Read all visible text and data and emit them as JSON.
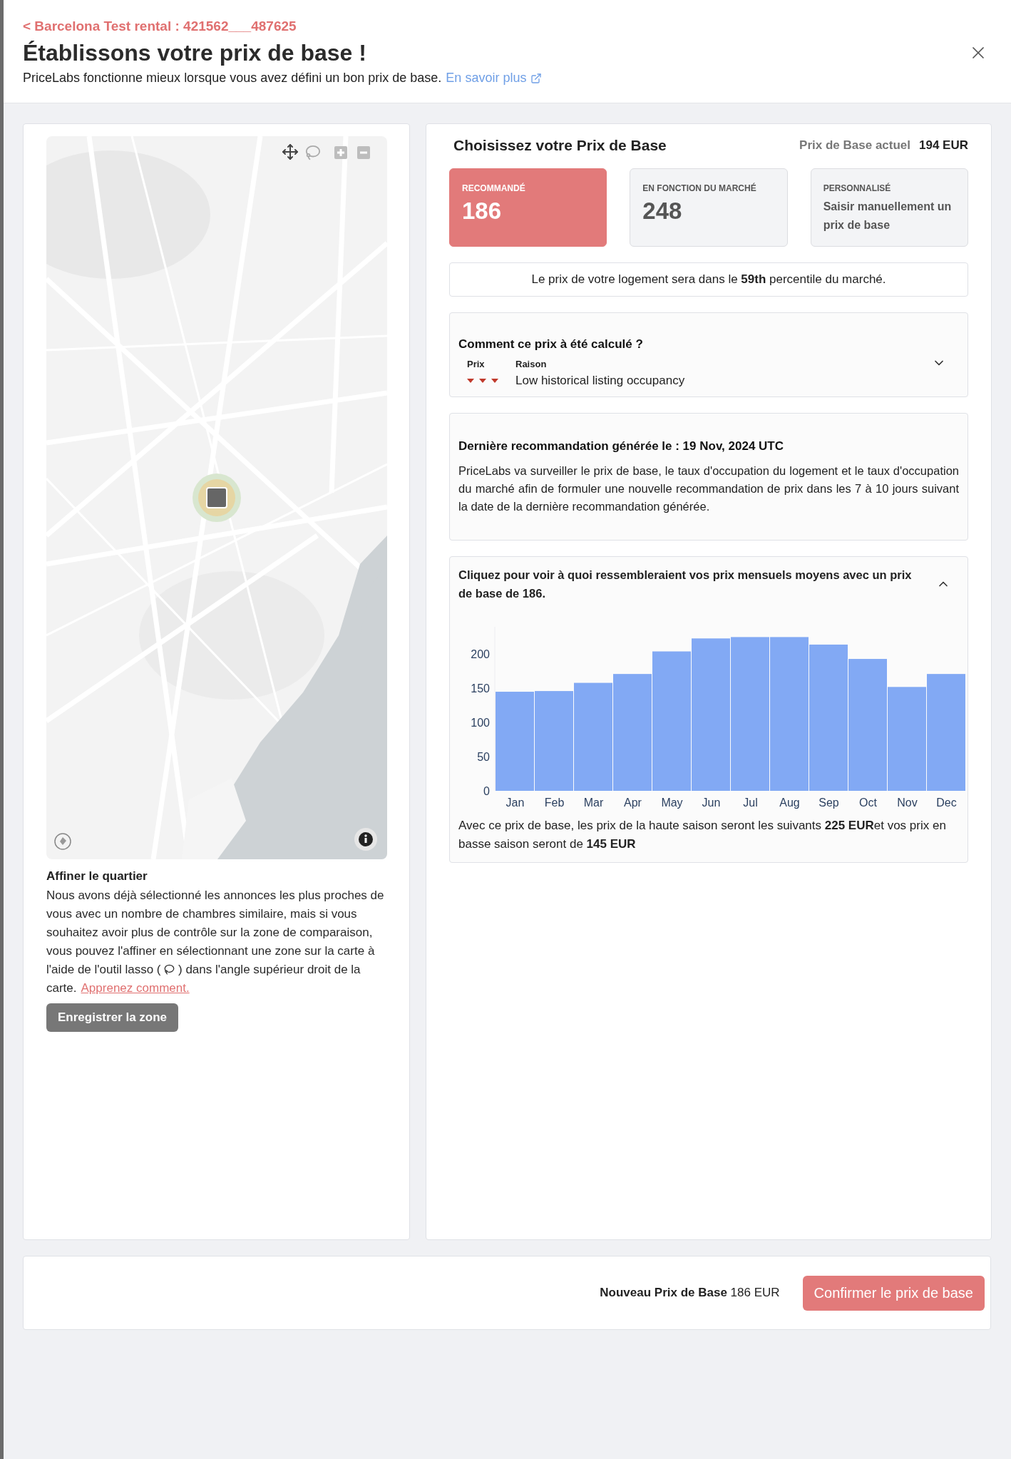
{
  "header": {
    "breadcrumb": "< Barcelona Test rental : 421562___487625",
    "title": "Établissons votre prix de base !",
    "subtitle": "PriceLabs fonctionne mieux lorsque vous avez défini un bon prix de base.",
    "learn_more_link": "En savoir plus"
  },
  "neighborhood": {
    "title": "Affiner le quartier",
    "text_before_icon": "Nous avons déjà sélectionné les annonces les plus proches de vous avec un nombre de chambres similaire, mais si vous souhaitez avoir plus de contrôle sur la zone de comparaison, vous pouvez l'affiner en sélectionnant une zone sur la carte à l'aide de l'outil lasso (",
    "text_after_icon": ") dans l'angle supérieur droit de la carte.",
    "link": "Apprenez comment.",
    "save_button": "Enregistrer la zone"
  },
  "price_panel": {
    "title": "Choisissez votre Prix de Base",
    "current_label": "Prix de Base actuel",
    "current_value": "194 EUR",
    "options": [
      {
        "kind": "value",
        "label": "RECOMMANDÉ",
        "value": "186",
        "selected": true
      },
      {
        "kind": "value",
        "label": "EN FONCTION DU MARCHÉ",
        "value": "248",
        "selected": false
      },
      {
        "kind": "custom",
        "label": "PERSONNALISÉ",
        "description": "Saisir manuellement un prix de base",
        "selected": false
      }
    ],
    "percentile_text": "Le prix de votre logement sera dans le **59th** percentile du marché.",
    "calculation": {
      "title": "Comment ce prix à été calculé ?",
      "expanded": false,
      "columns": [
        "Prix",
        "Raison"
      ],
      "reasons": [
        {
          "kind": "decrease",
          "text": "Low historical listing occupancy"
        }
      ]
    },
    "recommendation": {
      "title": "Dernière recommandation générée le : 19 Nov, 2024 UTC",
      "text": "PriceLabs va surveiller le prix de base, le taux d'occupation du logement et le taux d'occupation du marché afin de formuler une nouvelle recommandation de prix dans les 7 à 10 jours suivant la date de la dernière recommandation générée."
    },
    "monthly": {
      "title": "Cliquez pour voir à quoi ressembleraient vos prix mensuels moyens avec un prix de base de 186.",
      "expanded": true,
      "chart_data": {
        "type": "bar",
        "categories": [
          "Jan",
          "Feb",
          "Mar",
          "Apr",
          "May",
          "Jun",
          "Jul",
          "Aug",
          "Sep",
          "Oct",
          "Nov",
          "Dec"
        ],
        "values": [
          145,
          146,
          158,
          171,
          204,
          223,
          225,
          225,
          214,
          193,
          152,
          171
        ],
        "ylim": [
          0,
          240
        ],
        "yticks": [
          0,
          50,
          100,
          150,
          200
        ]
      },
      "summary": "Avec ce prix de base, les prix de la haute saison seront les suivants **225 EUR**et vos prix en basse saison seront de **145 EUR**"
    }
  },
  "footer": {
    "new_price": "**Nouveau Prix de Base** 186 EUR",
    "confirm_button": "Confirmer le prix de base"
  }
}
